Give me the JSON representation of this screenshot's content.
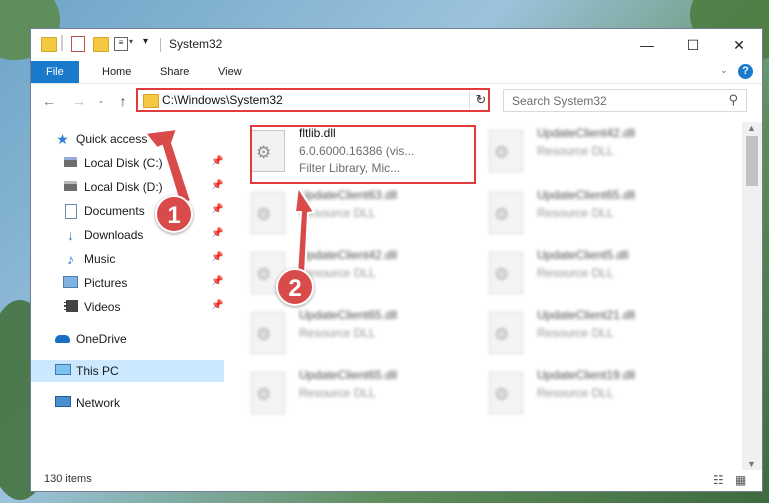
{
  "window": {
    "title": "System32"
  },
  "ribbon": {
    "tabs": [
      "File",
      "Home",
      "Share",
      "View"
    ]
  },
  "address": {
    "path": "C:\\Windows\\System32"
  },
  "search": {
    "placeholder": "Search System32"
  },
  "sidebar": {
    "items": [
      {
        "label": "Quick access",
        "icon": "star-icon"
      },
      {
        "label": "Local Disk (C:)",
        "icon": "drive-icon"
      },
      {
        "label": "Local Disk (D:)",
        "icon": "drive-icon"
      },
      {
        "label": "Documents",
        "icon": "documents-icon"
      },
      {
        "label": "Downloads",
        "icon": "download-icon"
      },
      {
        "label": "Music",
        "icon": "music-icon"
      },
      {
        "label": "Pictures",
        "icon": "pictures-icon"
      },
      {
        "label": "Videos",
        "icon": "videos-icon"
      },
      {
        "label": "OneDrive",
        "icon": "cloud-icon"
      },
      {
        "label": "This PC",
        "icon": "computer-icon"
      },
      {
        "label": "Network",
        "icon": "network-icon"
      }
    ]
  },
  "files": [
    {
      "name": "fltlib.dll",
      "line2": "6.0.6000.16386 (vis...",
      "line3": "Filter Library, Mic..."
    },
    {
      "name": "UpdateClient42.dll",
      "line2": "Resource DLL"
    },
    {
      "name": "UpdateClient63.dll",
      "line2": "Resource DLL"
    },
    {
      "name": "UpdateClient65.dll",
      "line2": "Resource DLL"
    },
    {
      "name": "UpdateClient42.dll",
      "line2": "Resource DLL"
    },
    {
      "name": "UpdateClient5.dll",
      "line2": "Resource DLL"
    },
    {
      "name": "UpdateClient65.dll",
      "line2": "Resource DLL"
    },
    {
      "name": "UpdateClient21.dll",
      "line2": "Resource DLL"
    },
    {
      "name": "UpdateClient65.dll",
      "line2": "Resource DLL"
    },
    {
      "name": "UpdateClient19.dll",
      "line2": "Resource DLL"
    }
  ],
  "status": {
    "count": "130 items"
  },
  "annotations": {
    "step1": "1",
    "step2": "2"
  },
  "colors": {
    "accent": "#1979ca",
    "highlight": "#e03c3c"
  }
}
